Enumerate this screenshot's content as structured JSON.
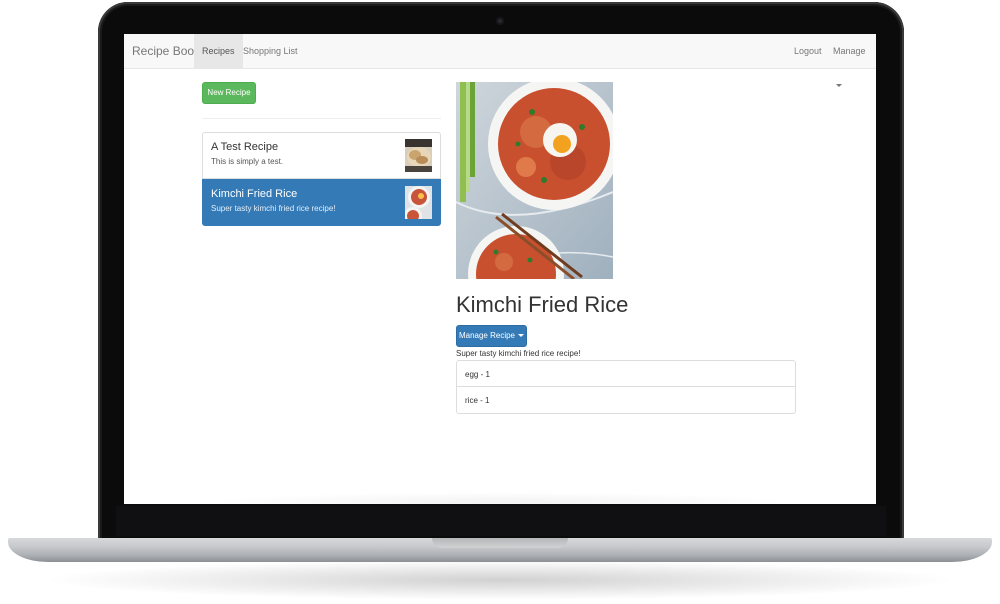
{
  "navbar": {
    "brand": "Recipe Book",
    "tabs": [
      {
        "label": "Recipes",
        "active": true
      },
      {
        "label": "Shopping List",
        "active": false
      }
    ],
    "logout": "Logout",
    "manage": "Manage"
  },
  "sidebar": {
    "new_recipe": "New Recipe",
    "recipes": [
      {
        "title": "A Test Recipe",
        "description": "This is simply a test.",
        "selected": false
      },
      {
        "title": "Kimchi Fried Rice",
        "description": "Super tasty kimchi fried rice recipe!",
        "selected": true
      }
    ]
  },
  "detail": {
    "title": "Kimchi Fried Rice",
    "manage_button": "Manage Recipe",
    "description": "Super tasty kimchi fried rice recipe!",
    "ingredients": [
      "egg - 1",
      "rice - 1"
    ]
  },
  "colors": {
    "success": "#5cb85c",
    "primary": "#337ab7",
    "navbar_bg": "#f8f8f8"
  },
  "icons": [
    "caret-down-icon"
  ]
}
